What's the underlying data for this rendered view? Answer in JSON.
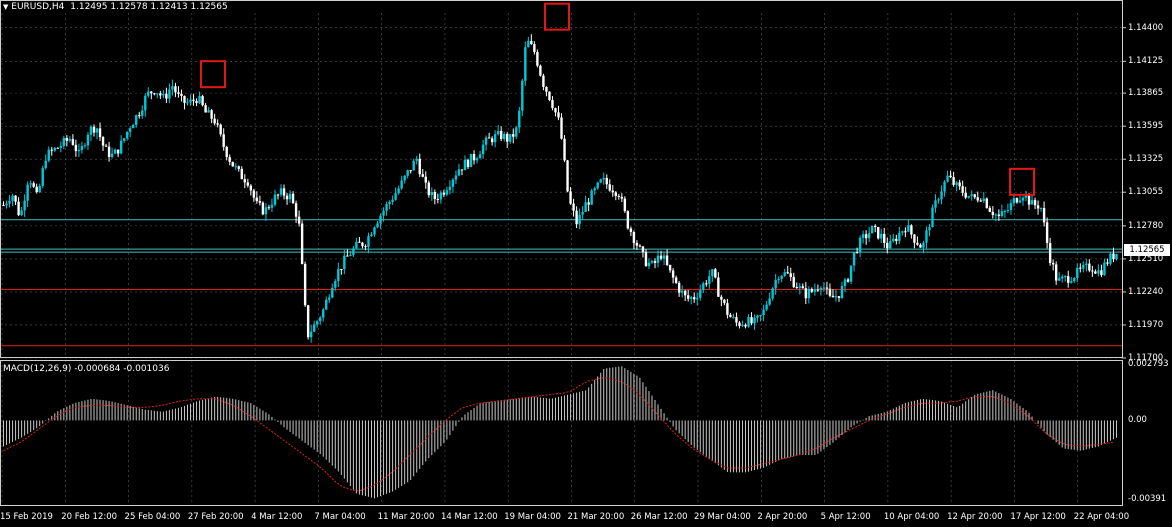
{
  "header": {
    "symbol": "EURUSD,H4",
    "ohlc": "1.12495 1.12578 1.12413 1.12565",
    "symbol_icon": "chart-type-triangle-icon"
  },
  "macd": {
    "label": "MACD(12,26,9) -0.000684 -0.001036",
    "axis_labels": [
      "0.002793",
      "0.00",
      "-0.00391"
    ]
  },
  "price_axis": {
    "labels": [
      "1.14400",
      "1.14125",
      "1.13865",
      "1.13595",
      "1.13325",
      "1.13055",
      "1.12780",
      "1.12510",
      "1.12240",
      "1.11970",
      "1.11700"
    ],
    "current_price": "1.12565"
  },
  "time_axis": {
    "labels": [
      "15 Feb 2019",
      "20 Feb 12:00",
      "25 Feb 04:00",
      "27 Feb 20:00",
      "4 Mar 12:00",
      "7 Mar 04:00",
      "11 Mar 20:00",
      "14 Mar 12:00",
      "19 Mar 04:00",
      "21 Mar 20:00",
      "26 Mar 12:00",
      "29 Mar 04:00",
      "2 Apr 20:00",
      "5 Apr 12:00",
      "10 Apr 04:00",
      "12 Apr 20:00",
      "17 Apr 12:00",
      "22 Apr 04:00"
    ]
  },
  "colors": {
    "background": "#000000",
    "grid": "#5a5a5a",
    "bull_candle": "#00c8d8",
    "bear_candle": "#ffffff",
    "horizontal_line_red": "#e02020",
    "horizontal_line_cyan": "#40c0c0",
    "marker_box": "#e01818",
    "macd_signal": "#e02020",
    "macd_histogram": "#c8c8c8"
  },
  "chart_data": [
    {
      "type": "candlestick",
      "symbol": "EURUSD",
      "timeframe": "H4",
      "ylim": [
        1.117,
        1.1452
      ],
      "y_ticks": [
        1.144,
        1.14125,
        1.13865,
        1.13595,
        1.13325,
        1.13055,
        1.1278,
        1.1251,
        1.1224,
        1.1197,
        1.117
      ],
      "x_range": [
        "15 Feb 2019",
        "22 Apr 04:00"
      ],
      "close_path": [
        1.1295,
        1.1305,
        1.1285,
        1.132,
        1.13,
        1.1335,
        1.134,
        1.1345,
        1.135,
        1.1335,
        1.1355,
        1.136,
        1.134,
        1.1335,
        1.1345,
        1.136,
        1.137,
        1.1385,
        1.139,
        1.1382,
        1.1393,
        1.138,
        1.1378,
        1.1383,
        1.137,
        1.1365,
        1.1345,
        1.133,
        1.132,
        1.1315,
        1.1295,
        1.129,
        1.13,
        1.1305,
        1.1302,
        1.1283,
        1.1188,
        1.1198,
        1.121,
        1.1232,
        1.1245,
        1.1255,
        1.1262,
        1.1265,
        1.128,
        1.129,
        1.13,
        1.131,
        1.1322,
        1.1333,
        1.131,
        1.13,
        1.1305,
        1.1315,
        1.1325,
        1.133,
        1.1335,
        1.1345,
        1.135,
        1.1352,
        1.1348,
        1.1358,
        1.143,
        1.142,
        1.1395,
        1.138,
        1.136,
        1.13,
        1.128,
        1.1295,
        1.1305,
        1.1315,
        1.131,
        1.1305,
        1.128,
        1.1265,
        1.125,
        1.1245,
        1.1255,
        1.124,
        1.1228,
        1.1218,
        1.122,
        1.123,
        1.124,
        1.122,
        1.1205,
        1.1198,
        1.12,
        1.1198,
        1.1205,
        1.1225,
        1.124,
        1.1238,
        1.123,
        1.1222,
        1.1225,
        1.1232,
        1.1218,
        1.1222,
        1.1232,
        1.1258,
        1.1268,
        1.1275,
        1.127,
        1.126,
        1.127,
        1.1278,
        1.1268,
        1.126,
        1.1285,
        1.1305,
        1.1318,
        1.131,
        1.1305,
        1.13,
        1.1303,
        1.1292,
        1.1285,
        1.129,
        1.13,
        1.1305,
        1.1295,
        1.1295,
        1.1255,
        1.1232,
        1.1235,
        1.1238,
        1.1242,
        1.1245,
        1.124,
        1.125,
        1.1256
      ],
      "horizontal_lines": [
        {
          "price": 1.1283,
          "color": "cyan"
        },
        {
          "price": 1.1259,
          "color": "cyan"
        },
        {
          "price": 1.12565,
          "color": "cyan"
        },
        {
          "price": 1.1226,
          "color": "red"
        },
        {
          "price": 1.118,
          "color": "red"
        }
      ],
      "marked_highs": [
        {
          "label": "27 Feb",
          "price": 1.1393
        },
        {
          "label": "20 Mar",
          "price": 1.144
        },
        {
          "label": "17 Apr",
          "price": 1.1305
        }
      ]
    },
    {
      "type": "bar",
      "name": "MACD(12,26,9)",
      "ylim": [
        -0.00391,
        0.002793
      ],
      "macd_last": -0.000684,
      "signal_last": -0.001036,
      "histogram_path": [
        -0.0012,
        -0.0008,
        -0.0003,
        0.0004,
        0.0008,
        0.001,
        0.0009,
        0.0007,
        0.0005,
        0.0004,
        0.0006,
        0.0009,
        0.0011,
        0.001,
        0.0008,
        0.0003,
        -0.0004,
        -0.001,
        -0.0016,
        -0.0024,
        -0.0034,
        -0.0036,
        -0.0033,
        -0.0028,
        -0.0018,
        -0.001,
        0.0002,
        0.0008,
        0.0009,
        0.001,
        0.0011,
        0.001,
        0.0012,
        0.0014,
        0.0024,
        0.0025,
        0.002,
        0.0008,
        -0.0004,
        -0.0012,
        -0.0018,
        -0.0024,
        -0.0024,
        -0.0022,
        -0.0018,
        -0.0016,
        -0.0016,
        -0.001,
        -0.0003,
        0.0002,
        0.0004,
        0.0008,
        0.001,
        0.0009,
        0.0006,
        0.0012,
        0.0014,
        0.001,
        0.0004,
        -0.0006,
        -0.0013,
        -0.0014,
        -0.0012,
        -0.0008
      ],
      "signal_path": [
        -0.0014,
        -0.001,
        -0.0004,
        0.0002,
        0.0006,
        0.0007,
        0.0007,
        0.0006,
        0.0006,
        0.0007,
        0.0009,
        0.001,
        0.001,
        0.0007,
        0.0002,
        -0.0004,
        -0.001,
        -0.0016,
        -0.0022,
        -0.003,
        -0.0033,
        -0.003,
        -0.0024,
        -0.0016,
        -0.0008,
        0.0,
        0.0006,
        0.0008,
        0.0009,
        0.001,
        0.0011,
        0.0012,
        0.0013,
        0.0018,
        0.002,
        0.0018,
        0.0012,
        0.0003,
        -0.0006,
        -0.0013,
        -0.0018,
        -0.0022,
        -0.0022,
        -0.002,
        -0.0018,
        -0.0016,
        -0.0013,
        -0.0008,
        -0.0004,
        0.0,
        0.0003,
        0.0006,
        0.0008,
        0.0008,
        0.0009,
        0.0011,
        0.0011,
        0.0008,
        0.0002,
        -0.0006,
        -0.0011,
        -0.0012,
        -0.0011,
        -0.001
      ]
    }
  ]
}
